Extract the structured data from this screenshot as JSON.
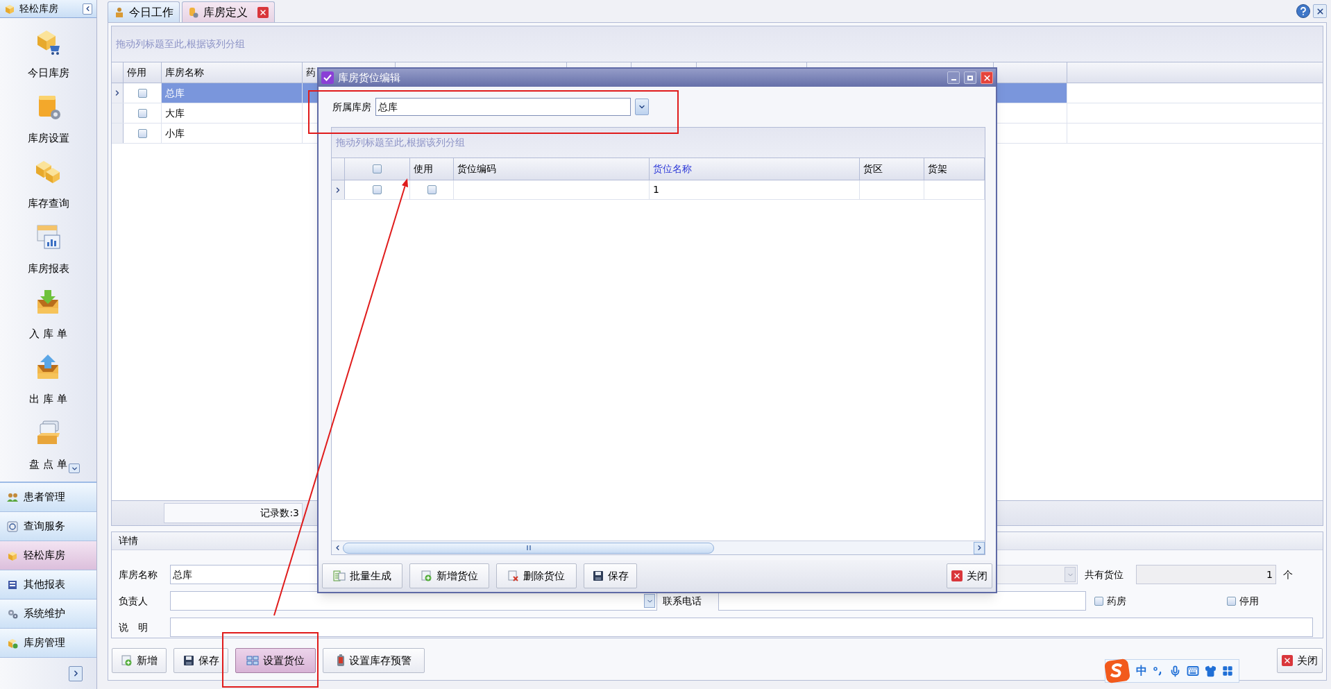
{
  "sidebar": {
    "title": "轻松库房",
    "items": [
      {
        "label": "今日库房"
      },
      {
        "label": "库房设置"
      },
      {
        "label": "库存查询"
      },
      {
        "label": "库房报表"
      },
      {
        "label": "入 库 单"
      },
      {
        "label": "出 库 单"
      },
      {
        "label": "盘 点 单"
      }
    ],
    "nav": [
      {
        "label": "患者管理",
        "selected": false
      },
      {
        "label": "查询服务",
        "selected": false
      },
      {
        "label": "轻松库房",
        "selected": true
      },
      {
        "label": "其他报表",
        "selected": false
      },
      {
        "label": "系统维护",
        "selected": false
      },
      {
        "label": "库房管理",
        "selected": false
      }
    ]
  },
  "tabs": [
    {
      "label": "今日工作",
      "selected": false,
      "closable": false
    },
    {
      "label": "库房定义",
      "selected": true,
      "closable": true
    }
  ],
  "main_grid": {
    "group_hint": "拖动列标题至此,根据该列分组",
    "columns": [
      "停用",
      "库房名称",
      "药"
    ],
    "rows": [
      {
        "disabled": false,
        "name": "总库",
        "selected": true
      },
      {
        "disabled": false,
        "name": "大库",
        "selected": false
      },
      {
        "disabled": false,
        "name": "小库",
        "selected": false
      }
    ],
    "footer": "记录数:3"
  },
  "details": {
    "title": "详情",
    "name_label": "库房名称",
    "name_value": "总库",
    "slots_label": "共有货位",
    "slots_value": "1",
    "slots_unit": "个",
    "manager_label": "负责人",
    "phone_label": "联系电话",
    "checkboxes": [
      {
        "label": "药房",
        "checked": false
      },
      {
        "label": "停用",
        "checked": false
      }
    ],
    "note_label": "说　明"
  },
  "toolbar": {
    "buttons": [
      {
        "label": "新增",
        "selected": false
      },
      {
        "label": "保存",
        "selected": false
      },
      {
        "label": "设置货位",
        "selected": true
      },
      {
        "label": "设置库存预警",
        "selected": false
      }
    ],
    "close": "关闭"
  },
  "dialog": {
    "title": "库房货位编辑",
    "warehouse_label": "所属库房",
    "warehouse_value": "总库",
    "grid": {
      "group_hint": "拖动列标题至此,根据该列分组",
      "all_checked": false,
      "columns": [
        {
          "label": "使用",
          "selected": false
        },
        {
          "label": "货位编码",
          "selected": false
        },
        {
          "label": "货位名称",
          "selected": true
        },
        {
          "label": "货区",
          "selected": false
        },
        {
          "label": "货架",
          "selected": false
        }
      ],
      "rows": [
        {
          "checked": false,
          "in_use": false,
          "name": "1"
        }
      ]
    },
    "buttons": [
      {
        "label": "批量生成"
      },
      {
        "label": "新增货位"
      },
      {
        "label": "删除货位"
      },
      {
        "label": "保存"
      }
    ],
    "close": "关闭"
  },
  "ime": {
    "mode": "中"
  }
}
